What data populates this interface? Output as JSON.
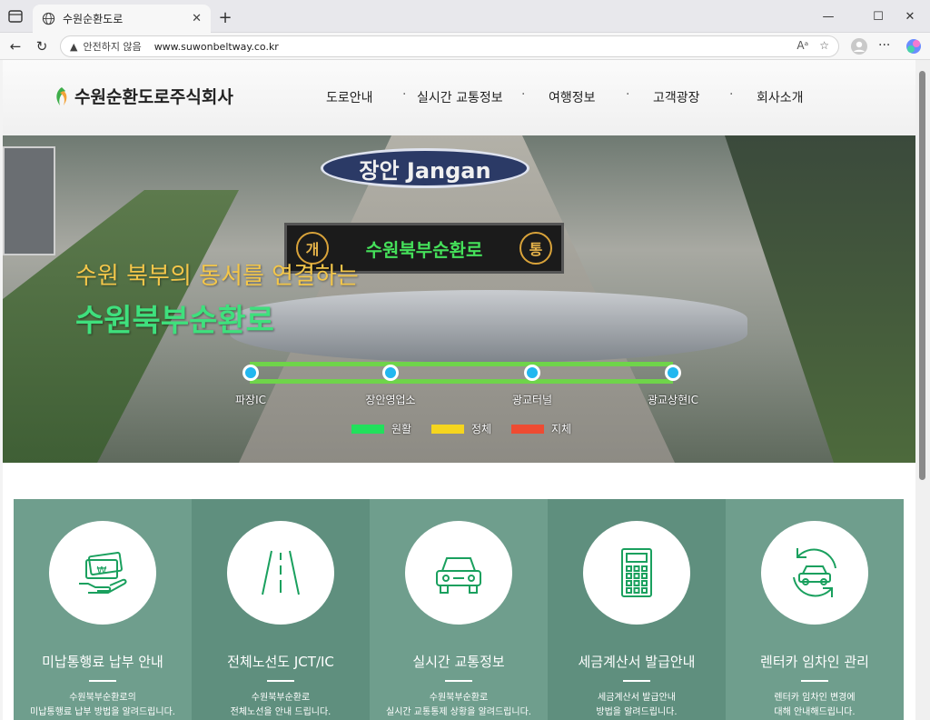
{
  "browser": {
    "tab_title": "수원순환도로",
    "security_warning": "안전하지 않음",
    "url": "www.suwonbeltway.co.kr"
  },
  "site": {
    "logo_text": "수원순환도로주식회사",
    "nav": [
      "도로안내",
      "실시간 교통정보",
      "여행정보",
      "고객광장",
      "회사소개"
    ]
  },
  "hero": {
    "sign_text": "장안 Jangan",
    "vms_left": "개",
    "vms_text": "수원북부순환로",
    "vms_right": "통",
    "subtitle": "수원 북부의 동서를 연결하는",
    "title": "수원북부순환로",
    "nodes": [
      "파장IC",
      "장안영업소",
      "광교터널",
      "광교상현IC"
    ],
    "legend": [
      {
        "label": "원활",
        "color": "#22e05c"
      },
      {
        "label": "정체",
        "color": "#f5d51e"
      },
      {
        "label": "지체",
        "color": "#ee4b32"
      }
    ]
  },
  "services": [
    {
      "title": "미납통행료 납부 안내",
      "desc": "수원북부순환로의\n미납통행료 납부 방법을 알려드립니다.",
      "icon": "toll-payment-icon"
    },
    {
      "title": "전체노선도 JCT/IC",
      "desc": "수원북부순환로\n전체노선을 안내 드립니다.",
      "icon": "road-icon"
    },
    {
      "title": "실시간 교통정보",
      "desc": "수원북부순환로\n실시간 교통통제 상황을 알려드립니다.",
      "icon": "car-icon"
    },
    {
      "title": "세금계산서 발급안내",
      "desc": "세금계산서 발급안내\n방법을 알려드립니다.",
      "icon": "calculator-icon"
    },
    {
      "title": "렌터카 임차인 관리",
      "desc": "렌터카 임차인 변경에\n대해 안내해드립니다.",
      "icon": "rental-car-icon"
    }
  ]
}
